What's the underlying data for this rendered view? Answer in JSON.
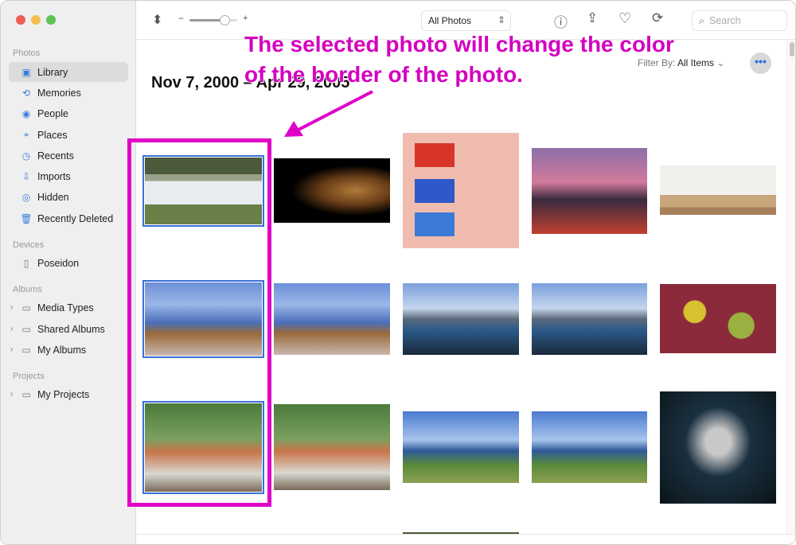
{
  "sidebar": {
    "sections": [
      {
        "label": "Photos",
        "items": [
          {
            "label": "Library",
            "icon": "library-icon",
            "selected": true
          },
          {
            "label": "Memories",
            "icon": "memories-icon"
          },
          {
            "label": "People",
            "icon": "people-icon"
          },
          {
            "label": "Places",
            "icon": "places-icon"
          },
          {
            "label": "Recents",
            "icon": "clock-icon"
          },
          {
            "label": "Imports",
            "icon": "imports-icon"
          },
          {
            "label": "Hidden",
            "icon": "eye-icon"
          },
          {
            "label": "Recently Deleted",
            "icon": "trash-icon"
          }
        ]
      },
      {
        "label": "Devices",
        "items": [
          {
            "label": "Poseidon",
            "icon": "device-icon"
          }
        ]
      },
      {
        "label": "Albums",
        "items": [
          {
            "label": "Media Types",
            "icon": "folder-icon"
          },
          {
            "label": "Shared Albums",
            "icon": "folder-icon"
          },
          {
            "label": "My Albums",
            "icon": "folder-icon"
          }
        ]
      },
      {
        "label": "Projects",
        "items": [
          {
            "label": "My Projects",
            "icon": "folder-icon"
          }
        ]
      }
    ]
  },
  "toolbar": {
    "zoom_minus": "−",
    "zoom_plus": "+",
    "zoom_level": 0.7,
    "view_select": "All Photos",
    "search_placeholder": "Search"
  },
  "main": {
    "title": "Nov 7, 2000 – Apr 29, 2005",
    "filter_label": "Filter By:",
    "filter_value": "All Items",
    "more": "•••"
  },
  "annotation": {
    "text_line1": "The selected photo will change the color",
    "text_line2": "of the border of the photo.",
    "color": "#e000c8"
  },
  "selection_color": "#3a6fd8"
}
